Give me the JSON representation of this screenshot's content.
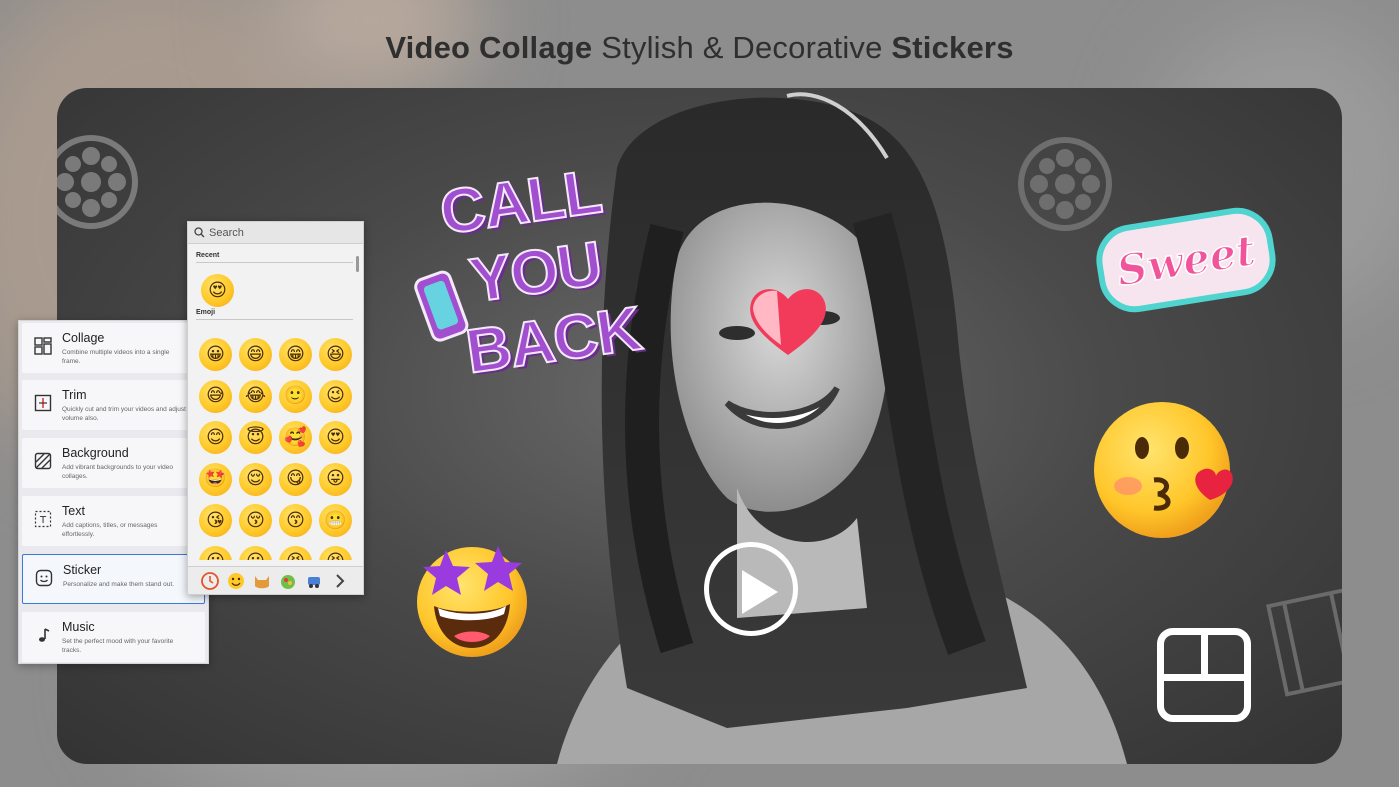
{
  "headline": {
    "part1": "Video Collage",
    "part2": " Stylish & Decorative ",
    "part3": "Stickers"
  },
  "stickers": {
    "call_you_back": [
      "CALL",
      "YOU",
      "BACK"
    ],
    "sweet": "Sweet"
  },
  "picker": {
    "search_placeholder": "Search",
    "recent_label": "Recent",
    "emoji_label": "Emoji",
    "recent": [
      "😍"
    ],
    "emojis": [
      "😀",
      "😄",
      "😁",
      "😆",
      "😅",
      "😂",
      "🙂",
      "😉",
      "😊",
      "😇",
      "🥰",
      "😍",
      "🤩",
      "😌",
      "😋",
      "😛",
      "😘",
      "😚",
      "😙",
      "😬",
      "😶",
      "😐",
      "😆",
      "😆"
    ],
    "tabs": [
      "clock-icon",
      "smiley-icon",
      "cat-icon",
      "food-icon",
      "travel-icon",
      "more-icon"
    ]
  },
  "menu": {
    "items": [
      {
        "title": "Collage",
        "desc": "Combine multiple videos into a single frame.",
        "icon": "collage-icon"
      },
      {
        "title": "Trim",
        "desc": "Quickly cut and trim your videos and adjust volume also.",
        "icon": "trim-icon"
      },
      {
        "title": "Background",
        "desc": "Add vibrant backgrounds to your video collages.",
        "icon": "background-icon"
      },
      {
        "title": "Text",
        "desc": "Add captions, titles, or messages effortlessly.",
        "icon": "text-icon"
      },
      {
        "title": "Sticker",
        "desc": "Personalize and make them stand out.",
        "icon": "sticker-icon"
      },
      {
        "title": "Music",
        "desc": "Set the perfect mood with your favorite tracks.",
        "icon": "music-icon"
      }
    ],
    "active": "Sticker"
  },
  "colors": {
    "accent": "#3b78d8",
    "sticker_purple": "#a24fcf",
    "sweet_pink": "#f1549a",
    "sweet_teal": "#4fd4cf"
  }
}
